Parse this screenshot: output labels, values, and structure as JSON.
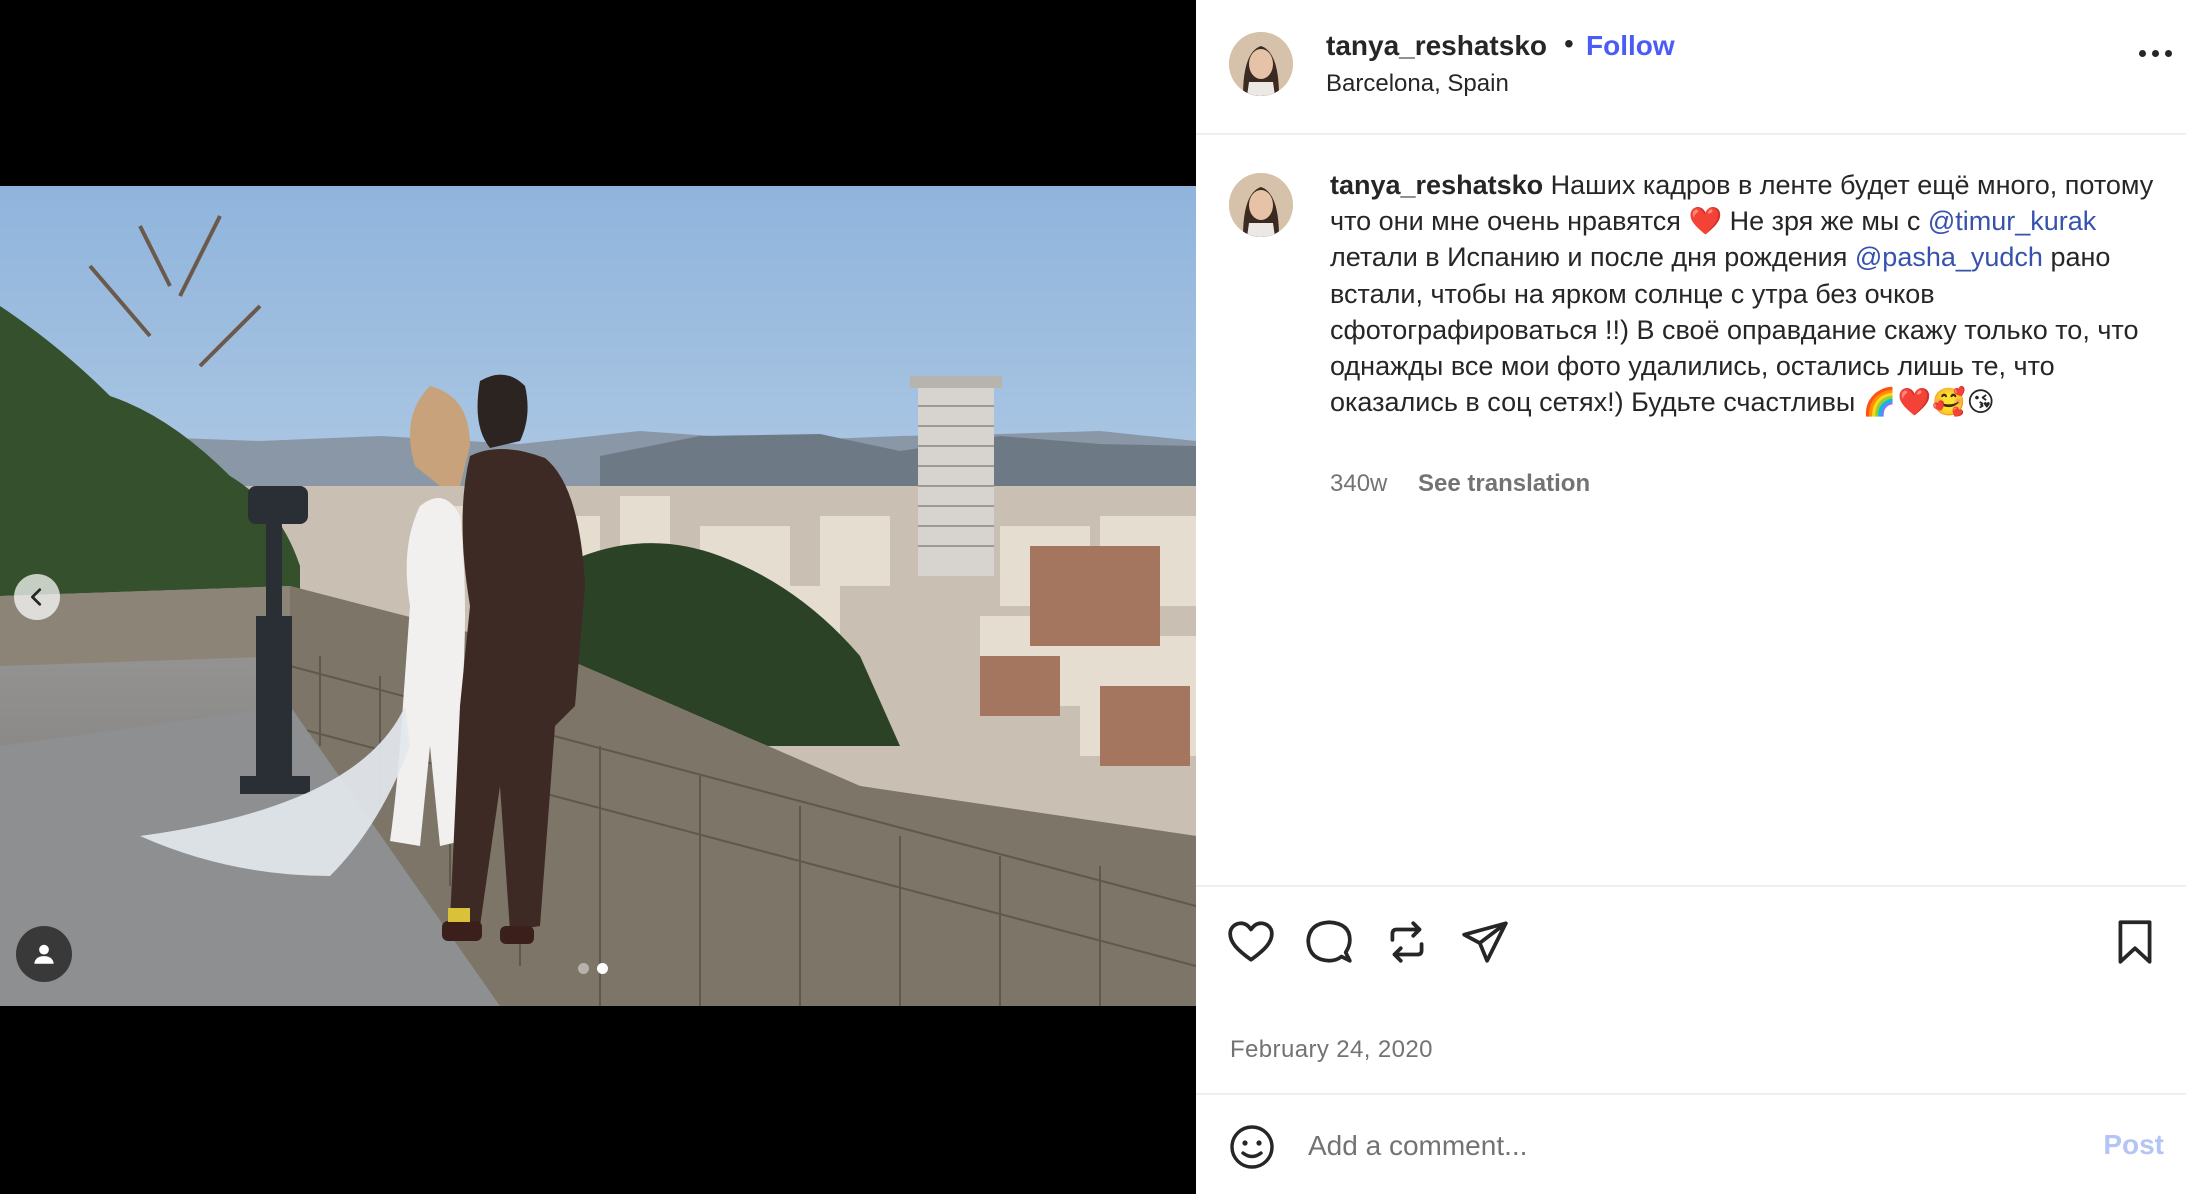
{
  "post": {
    "username": "tanya_reshatsko",
    "separator": "•",
    "follow_label": "Follow",
    "location": "Barcelona, Spain",
    "more_icon": "more-horizontal-icon"
  },
  "caption": {
    "username": "tanya_reshatsko",
    "text_1": " Наших кадров в ленте будет ещё много, потому что они мне очень нравятся ",
    "emoji_1": "❤️",
    "text_2": " Не зря же мы с ",
    "mention_1": "@timur_kurak",
    "text_3": " летали в Испанию и после дня рождения ",
    "mention_2": "@pasha_yudch",
    "text_4": " рано встали, чтобы на ярком солнце с утра без очков сфотографироваться !!) В своё оправдание скажу только то, что однажды все мои фото удалились, остались лишь те, что оказались в соц сетях!) Будьте счастливы ",
    "emoji_2": "🌈❤️🥰😘",
    "time": "340w",
    "see_translation": "See translation"
  },
  "media": {
    "carousel_total": 2,
    "carousel_active": 2,
    "prev_icon": "chevron-left-icon",
    "tag_icon": "user-tag-icon"
  },
  "actions": {
    "icons": [
      "heart-icon",
      "comment-icon",
      "repost-icon",
      "share-icon",
      "bookmark-icon"
    ]
  },
  "date": "February 24, 2020",
  "comment_box": {
    "placeholder": "Add a comment...",
    "post_label": "Post",
    "emoji_icon": "emoji-smile-icon"
  },
  "colors": {
    "follow": "#4a5cf5",
    "mention": "#3752ad",
    "post_disabled": "#b3c4f5",
    "muted_text": "#737373"
  }
}
